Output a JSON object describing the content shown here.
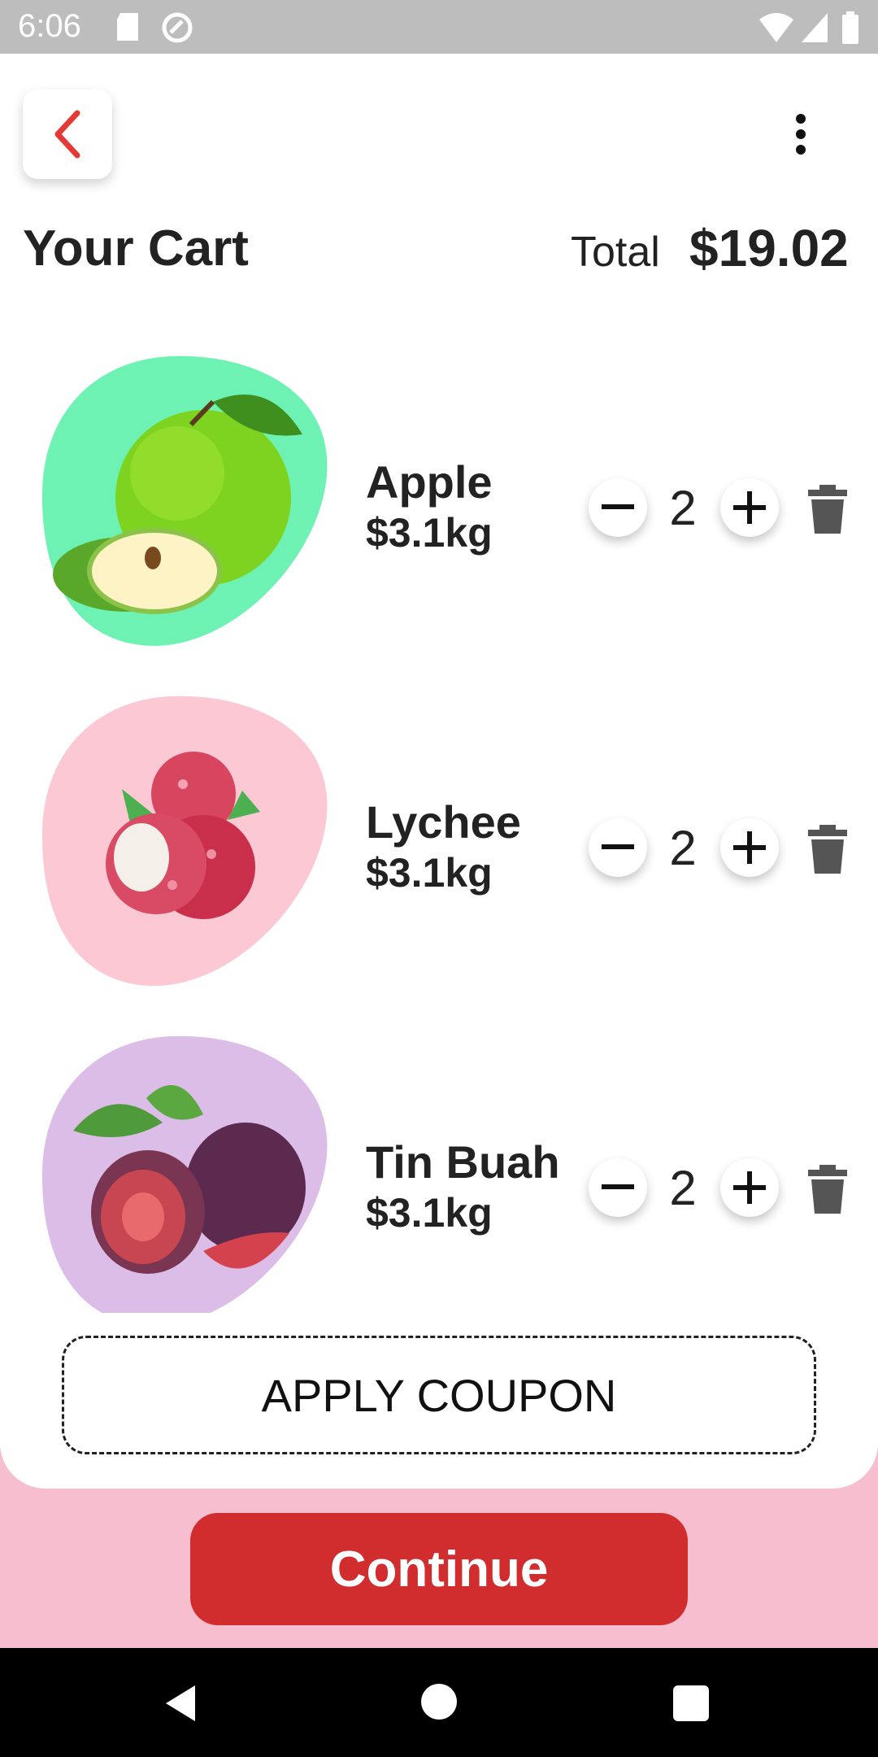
{
  "status_bar": {
    "time": "6:06"
  },
  "header": {
    "title": "Your Cart",
    "total_label": "Total",
    "total_value": "$19.02"
  },
  "items": [
    {
      "name": "Apple",
      "price": "$3.1kg",
      "qty": "2",
      "blob_color": "#6ef2b4"
    },
    {
      "name": "Lychee",
      "price": "$3.1kg",
      "qty": "2",
      "blob_color": "#fcc8d4"
    },
    {
      "name": "Tin Buah",
      "price": "$3.1kg",
      "qty": "2",
      "blob_color": "#dcbde8"
    }
  ],
  "coupon_label": "APPLY COUPON",
  "continue_label": "Continue",
  "colors": {
    "accent": "#d12d2f",
    "footer_bg": "#f7bed0",
    "back_arrow": "#e53935"
  }
}
